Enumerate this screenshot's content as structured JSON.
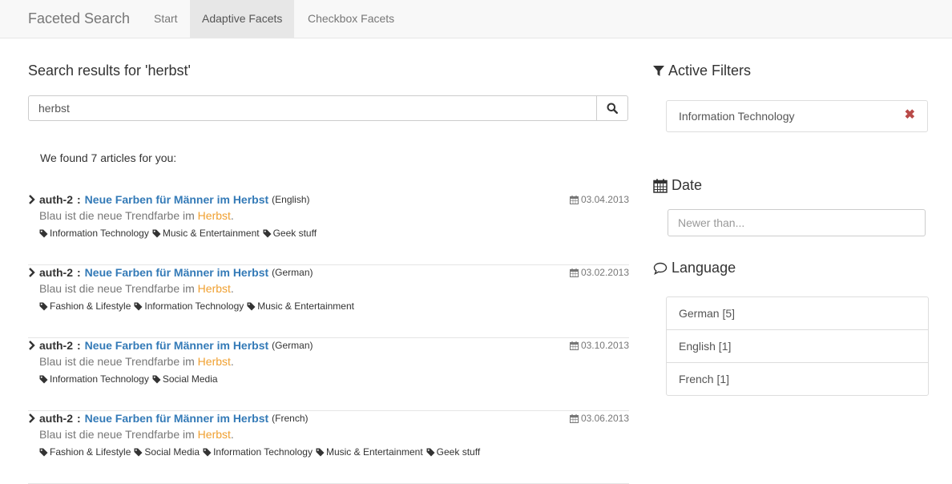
{
  "navbar": {
    "brand": "Faceted Search",
    "items": [
      {
        "label": "Start",
        "active": false
      },
      {
        "label": "Adaptive Facets",
        "active": true
      },
      {
        "label": "Checkbox Facets",
        "active": false
      }
    ]
  },
  "search": {
    "heading": "Search results for 'herbst'",
    "value": "herbst",
    "button_icon": "search-icon"
  },
  "results_summary": "We found 7 articles for you:",
  "results": [
    {
      "author": "auth-2",
      "separator": ":",
      "title": "Neue Farben für Männer im Herbst",
      "language": "(English)",
      "date": "03.04.2013",
      "snippet_before": "Blau ist die neue Trendfarbe im ",
      "snippet_highlight": "Herbst",
      "snippet_after": ".",
      "tags": [
        "Information Technology",
        "Music & Entertainment",
        "Geek stuff"
      ]
    },
    {
      "author": "auth-2",
      "separator": ":",
      "title": "Neue Farben für Männer im Herbst",
      "language": "(German)",
      "date": "03.02.2013",
      "snippet_before": "Blau ist die neue Trendfarbe im ",
      "snippet_highlight": "Herbst",
      "snippet_after": ".",
      "tags": [
        "Fashion & Lifestyle",
        "Information Technology",
        "Music & Entertainment"
      ]
    },
    {
      "author": "auth-2",
      "separator": ":",
      "title": "Neue Farben für Männer im Herbst",
      "language": "(German)",
      "date": "03.10.2013",
      "snippet_before": "Blau ist die neue Trendfarbe im ",
      "snippet_highlight": "Herbst",
      "snippet_after": ".",
      "tags": [
        "Information Technology",
        "Social Media"
      ]
    },
    {
      "author": "auth-2",
      "separator": ":",
      "title": "Neue Farben für Männer im Herbst",
      "language": "(French)",
      "date": "03.06.2013",
      "snippet_before": "Blau ist die neue Trendfarbe im ",
      "snippet_highlight": "Herbst",
      "snippet_after": ".",
      "tags": [
        "Fashion & Lifestyle",
        "Social Media",
        "Information Technology",
        "Music & Entertainment",
        "Geek stuff"
      ]
    }
  ],
  "sidebar": {
    "active_filters": {
      "heading": "Active Filters",
      "icon": "filter-icon",
      "items": [
        {
          "label": "Information Technology",
          "remove_icon": "close-icon"
        }
      ]
    },
    "date": {
      "heading": "Date",
      "icon": "calendar-icon",
      "placeholder": "Newer than..."
    },
    "language": {
      "heading": "Language",
      "icon": "speech-bubble-icon",
      "items": [
        {
          "label": "German [5]"
        },
        {
          "label": "English [1]"
        },
        {
          "label": "French [1]"
        }
      ]
    }
  },
  "colors": {
    "link": "#337ab7",
    "highlight": "#f0a030",
    "remove": "#b94a48",
    "navbar_bg": "#f8f8f8",
    "navbar_active_bg": "#e7e7e7"
  }
}
